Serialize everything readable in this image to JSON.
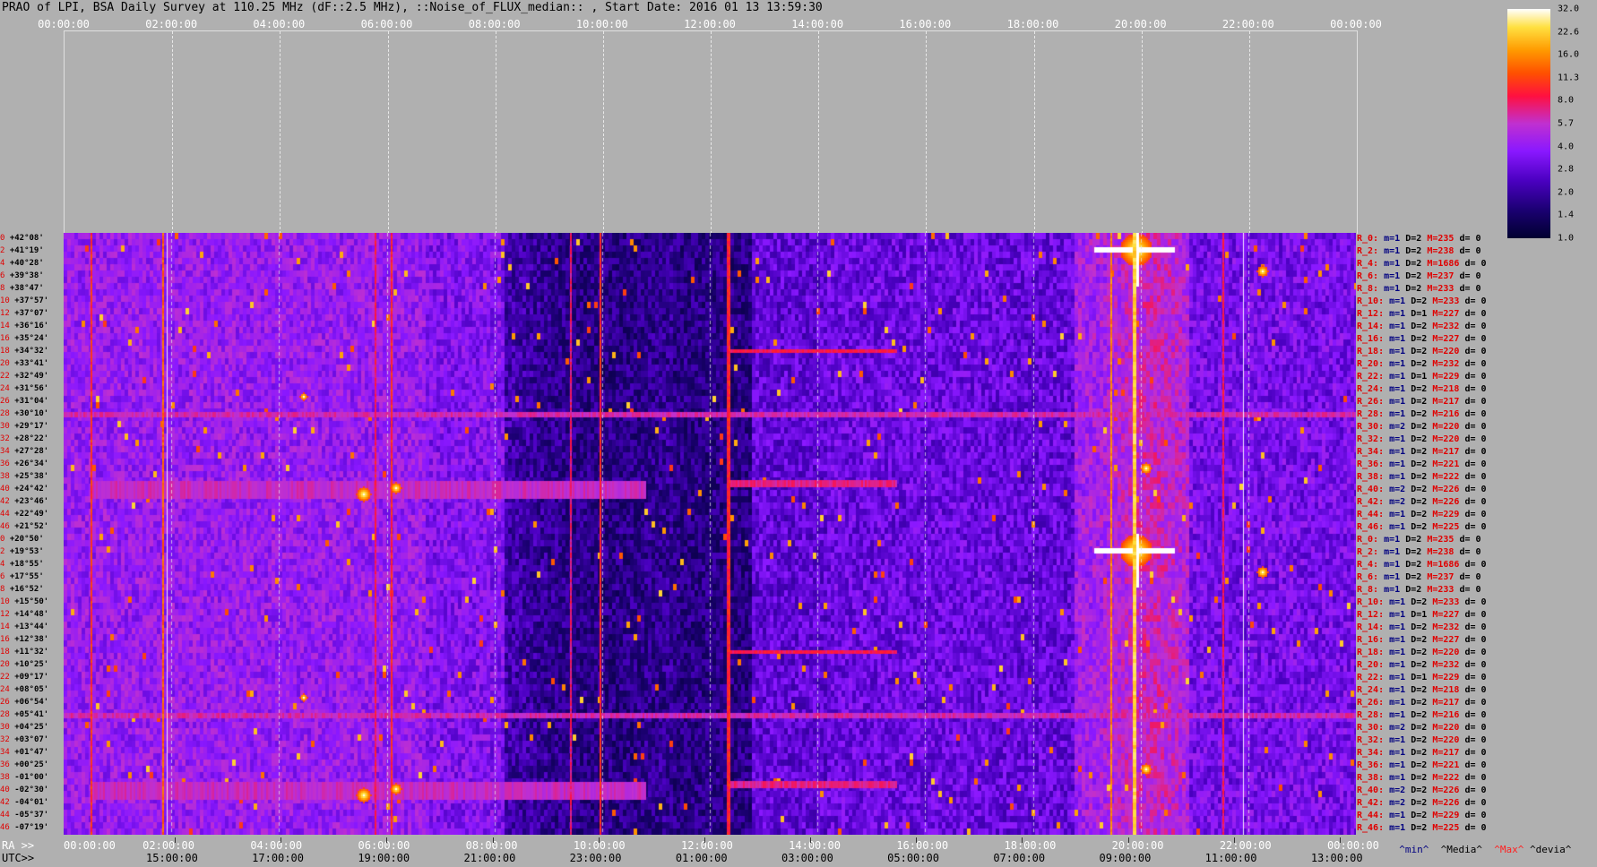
{
  "title": "PRAO of LPI, BSA Daily Survey at 110.25 MHz (dF::2.5 MHz), ::Noise_of_FLUX_median:: , Start Date: 2016 01 13 13:59:30",
  "chart_data": {
    "type": "heatmap",
    "top_axis": [
      "00:00:00",
      "02:00:00",
      "04:00:00",
      "06:00:00",
      "08:00:00",
      "10:00:00",
      "12:00:00",
      "14:00:00",
      "16:00:00",
      "18:00:00",
      "20:00:00",
      "22:00:00",
      "00:00:00"
    ],
    "ra_axis_prefix": "RA >>",
    "ra_axis": [
      "00:00:00",
      "02:00:00",
      "04:00:00",
      "06:00:00",
      "08:00:00",
      "10:00:00",
      "12:00:00",
      "14:00:00",
      "16:00:00",
      "18:00:00",
      "20:00:00",
      "22:00:00",
      "00:00:00"
    ],
    "utc_axis_prefix": "UTC>>",
    "utc_axis": [
      "15:00:00",
      "17:00:00",
      "19:00:00",
      "21:00:00",
      "23:00:00",
      "01:00:00",
      "03:00:00",
      "05:00:00",
      "07:00:00",
      "09:00:00",
      "11:00:00",
      "13:00:00"
    ],
    "declinations": [
      "+42°08'",
      "+41°19'",
      "+40°28'",
      "+39°38'",
      "+38°47'",
      "+37°57'",
      "+37°07'",
      "+36°16'",
      "+35°24'",
      "+34°32'",
      "+33°41'",
      "+32°49'",
      "+31°56'",
      "+31°04'",
      "+30°10'",
      "+29°17'",
      "+28°22'",
      "+27°28'",
      "+26°34'",
      "+25°38'",
      "+24°42'",
      "+23°46'",
      "+22°49'",
      "+21°52'",
      "+20°50'",
      "+19°53'",
      "+18°55'",
      "+17°55'",
      "+16°52'",
      "+15°50'",
      "+14°48'",
      "+13°44'",
      "+12°38'",
      "+11°32'",
      "+10°25'",
      "+09°17'",
      "+08°05'",
      "+06°54'",
      "+05°41'",
      "+04°25'",
      "+03°07'",
      "+01°47'",
      "+00°25'",
      "-01°00'",
      "-02°30'",
      "-04°01'",
      "-05°37'",
      "-07°19'"
    ],
    "row_indices": [
      "0",
      "2",
      "4",
      "6",
      "8",
      "10",
      "12",
      "14",
      "16",
      "18",
      "20",
      "22",
      "24",
      "26",
      "28",
      "30",
      "32",
      "34",
      "36",
      "38",
      "40",
      "42",
      "44",
      "46",
      "0",
      "2",
      "4",
      "6",
      "8",
      "10",
      "12",
      "14",
      "16",
      "18",
      "20",
      "22",
      "24",
      "26",
      "28",
      "30",
      "32",
      "34",
      "36",
      "38",
      "40",
      "42",
      "44",
      "46"
    ],
    "row_stats": [
      {
        "r": "R_0:",
        "m": "m=1",
        "d": "D=2",
        "M": "M=235",
        "dd": "d= 0"
      },
      {
        "r": "R_2:",
        "m": "m=1",
        "d": "D=2",
        "M": "M=238",
        "dd": "d= 0"
      },
      {
        "r": "R_4:",
        "m": "m=1",
        "d": "D=2",
        "M": "M=1686",
        "dd": "d= 0"
      },
      {
        "r": "R_6:",
        "m": "m=1",
        "d": "D=2",
        "M": "M=237",
        "dd": "d= 0"
      },
      {
        "r": "R_8:",
        "m": "m=1",
        "d": "D=2",
        "M": "M=233",
        "dd": "d= 0"
      },
      {
        "r": "R_10:",
        "m": "m=1",
        "d": "D=2",
        "M": "M=233",
        "dd": "d= 0"
      },
      {
        "r": "R_12:",
        "m": "m=1",
        "d": "D=1",
        "M": "M=227",
        "dd": "d= 0"
      },
      {
        "r": "R_14:",
        "m": "m=1",
        "d": "D=2",
        "M": "M=232",
        "dd": "d= 0"
      },
      {
        "r": "R_16:",
        "m": "m=1",
        "d": "D=2",
        "M": "M=227",
        "dd": "d= 0"
      },
      {
        "r": "R_18:",
        "m": "m=1",
        "d": "D=2",
        "M": "M=220",
        "dd": "d= 0"
      },
      {
        "r": "R_20:",
        "m": "m=1",
        "d": "D=2",
        "M": "M=232",
        "dd": "d= 0"
      },
      {
        "r": "R_22:",
        "m": "m=1",
        "d": "D=1",
        "M": "M=229",
        "dd": "d= 0"
      },
      {
        "r": "R_24:",
        "m": "m=1",
        "d": "D=2",
        "M": "M=218",
        "dd": "d= 0"
      },
      {
        "r": "R_26:",
        "m": "m=1",
        "d": "D=2",
        "M": "M=217",
        "dd": "d= 0"
      },
      {
        "r": "R_28:",
        "m": "m=1",
        "d": "D=2",
        "M": "M=216",
        "dd": "d= 0"
      },
      {
        "r": "R_30:",
        "m": "m=2",
        "d": "D=2",
        "M": "M=220",
        "dd": "d= 0"
      },
      {
        "r": "R_32:",
        "m": "m=1",
        "d": "D=2",
        "M": "M=220",
        "dd": "d= 0"
      },
      {
        "r": "R_34:",
        "m": "m=1",
        "d": "D=2",
        "M": "M=217",
        "dd": "d= 0"
      },
      {
        "r": "R_36:",
        "m": "m=1",
        "d": "D=2",
        "M": "M=221",
        "dd": "d= 0"
      },
      {
        "r": "R_38:",
        "m": "m=1",
        "d": "D=2",
        "M": "M=222",
        "dd": "d= 0"
      },
      {
        "r": "R_40:",
        "m": "m=2",
        "d": "D=2",
        "M": "M=226",
        "dd": "d= 0"
      },
      {
        "r": "R_42:",
        "m": "m=2",
        "d": "D=2",
        "M": "M=226",
        "dd": "d= 0"
      },
      {
        "r": "R_44:",
        "m": "m=1",
        "d": "D=2",
        "M": "M=229",
        "dd": "d= 0"
      },
      {
        "r": "R_46:",
        "m": "m=1",
        "d": "D=2",
        "M": "M=225",
        "dd": "d= 0"
      },
      {
        "r": "R_0:",
        "m": "m=1",
        "d": "D=2",
        "M": "M=235",
        "dd": "d= 0"
      },
      {
        "r": "R_2:",
        "m": "m=1",
        "d": "D=2",
        "M": "M=238",
        "dd": "d= 0"
      },
      {
        "r": "R_4:",
        "m": "m=1",
        "d": "D=2",
        "M": "M=1686",
        "dd": "d= 0"
      },
      {
        "r": "R_6:",
        "m": "m=1",
        "d": "D=2",
        "M": "M=237",
        "dd": "d= 0"
      },
      {
        "r": "R_8:",
        "m": "m=1",
        "d": "D=2",
        "M": "M=233",
        "dd": "d= 0"
      },
      {
        "r": "R_10:",
        "m": "m=1",
        "d": "D=2",
        "M": "M=233",
        "dd": "d= 0"
      },
      {
        "r": "R_12:",
        "m": "m=1",
        "d": "D=1",
        "M": "M=227",
        "dd": "d= 0"
      },
      {
        "r": "R_14:",
        "m": "m=1",
        "d": "D=2",
        "M": "M=232",
        "dd": "d= 0"
      },
      {
        "r": "R_16:",
        "m": "m=1",
        "d": "D=2",
        "M": "M=227",
        "dd": "d= 0"
      },
      {
        "r": "R_18:",
        "m": "m=1",
        "d": "D=2",
        "M": "M=220",
        "dd": "d= 0"
      },
      {
        "r": "R_20:",
        "m": "m=1",
        "d": "D=2",
        "M": "M=232",
        "dd": "d= 0"
      },
      {
        "r": "R_22:",
        "m": "m=1",
        "d": "D=1",
        "M": "M=229",
        "dd": "d= 0"
      },
      {
        "r": "R_24:",
        "m": "m=1",
        "d": "D=2",
        "M": "M=218",
        "dd": "d= 0"
      },
      {
        "r": "R_26:",
        "m": "m=1",
        "d": "D=2",
        "M": "M=217",
        "dd": "d= 0"
      },
      {
        "r": "R_28:",
        "m": "m=1",
        "d": "D=2",
        "M": "M=216",
        "dd": "d= 0"
      },
      {
        "r": "R_30:",
        "m": "m=2",
        "d": "D=2",
        "M": "M=220",
        "dd": "d= 0"
      },
      {
        "r": "R_32:",
        "m": "m=1",
        "d": "D=2",
        "M": "M=220",
        "dd": "d= 0"
      },
      {
        "r": "R_34:",
        "m": "m=1",
        "d": "D=2",
        "M": "M=217",
        "dd": "d= 0"
      },
      {
        "r": "R_36:",
        "m": "m=1",
        "d": "D=2",
        "M": "M=221",
        "dd": "d= 0"
      },
      {
        "r": "R_38:",
        "m": "m=1",
        "d": "D=2",
        "M": "M=222",
        "dd": "d= 0"
      },
      {
        "r": "R_40:",
        "m": "m=2",
        "d": "D=2",
        "M": "M=226",
        "dd": "d= 0"
      },
      {
        "r": "R_42:",
        "m": "m=2",
        "d": "D=2",
        "M": "M=226",
        "dd": "d= 0"
      },
      {
        "r": "R_44:",
        "m": "m=1",
        "d": "D=2",
        "M": "M=229",
        "dd": "d= 0"
      },
      {
        "r": "R_46:",
        "m": "m=1",
        "d": "D=2",
        "M": "M=225",
        "dd": "d= 0"
      }
    ],
    "colorbar_labels": [
      "32.0",
      "22.6",
      "16.0",
      "11.3",
      "8.0",
      "5.7",
      "4.0",
      "2.8",
      "2.0",
      "1.4",
      "1.0"
    ],
    "colormap": [
      "#000030",
      "#1a0070",
      "#4a00c0",
      "#8a18ff",
      "#c030d0",
      "#ff1040",
      "#ff5000",
      "#ff9a00",
      "#ffe040",
      "#ffffff"
    ],
    "legend": {
      "min": "^min^",
      "media": "^Media^",
      "max": "^Max^",
      "devia": "^devia^"
    },
    "legend_colors": {
      "min": "#000080",
      "media": "#000000",
      "max": "#ff2020",
      "devia": "#000000"
    }
  }
}
